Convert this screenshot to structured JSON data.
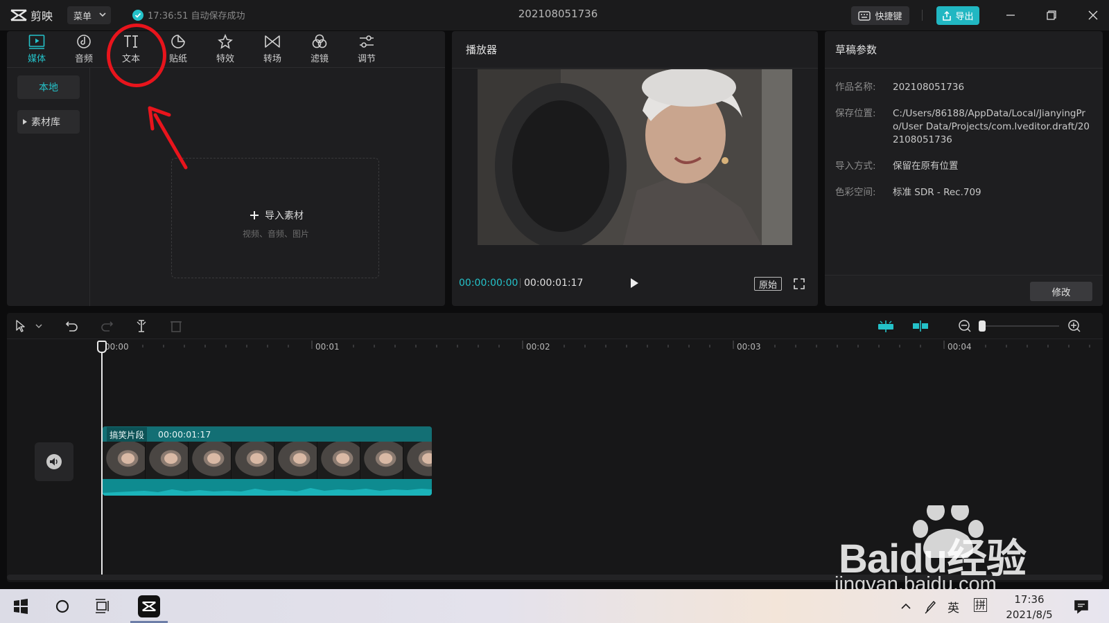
{
  "titlebar": {
    "app_name": "剪映",
    "menu_label": "菜单",
    "autosave_text": "17:36:51 自动保存成功",
    "project_title": "202108051736",
    "shortcut_label": "快捷键",
    "export_label": "导出"
  },
  "media_tabs": [
    {
      "label": "媒体",
      "icon": "media-icon",
      "active": true
    },
    {
      "label": "音频",
      "icon": "audio-icon"
    },
    {
      "label": "文本",
      "icon": "text-icon"
    },
    {
      "label": "贴纸",
      "icon": "sticker-icon"
    },
    {
      "label": "特效",
      "icon": "effects-icon"
    },
    {
      "label": "转场",
      "icon": "transition-icon"
    },
    {
      "label": "滤镜",
      "icon": "filter-icon"
    },
    {
      "label": "调节",
      "icon": "adjust-icon"
    }
  ],
  "media_side": {
    "local": "本地",
    "library": "素材库"
  },
  "import": {
    "label": "导入素材",
    "hint": "视频、音频、图片"
  },
  "player": {
    "header": "播放器",
    "current_time": "00:00:00:00",
    "total_time": "00:00:01:17",
    "original_label": "原始"
  },
  "params": {
    "header": "草稿参数",
    "rows": [
      {
        "key": "作品名称:",
        "value": "202108051736"
      },
      {
        "key": "保存位置:",
        "value": "C:/Users/86188/AppData/Local/JianyingPro/User Data/Projects/com.lveditor.draft/202108051736"
      },
      {
        "key": "导入方式:",
        "value": "保留在原有位置"
      },
      {
        "key": "色彩空间:",
        "value": "标准 SDR - Rec.709"
      }
    ],
    "modify_label": "修改"
  },
  "timeline": {
    "ruler_labels": [
      "00:00",
      "00:01",
      "00:02",
      "00:03",
      "00:04"
    ],
    "clip_name": "搞笑片段",
    "clip_duration": "00:00:01:17"
  },
  "watermark": {
    "brand": "Baidu经验",
    "url": "jingyan.baidu.com"
  },
  "taskbar": {
    "ime_lang": "英",
    "ime_mode": "拼",
    "time": "17:36",
    "date": "2021/8/5"
  },
  "colors": {
    "accent": "#24c2c9",
    "annotation": "#e8141c"
  }
}
